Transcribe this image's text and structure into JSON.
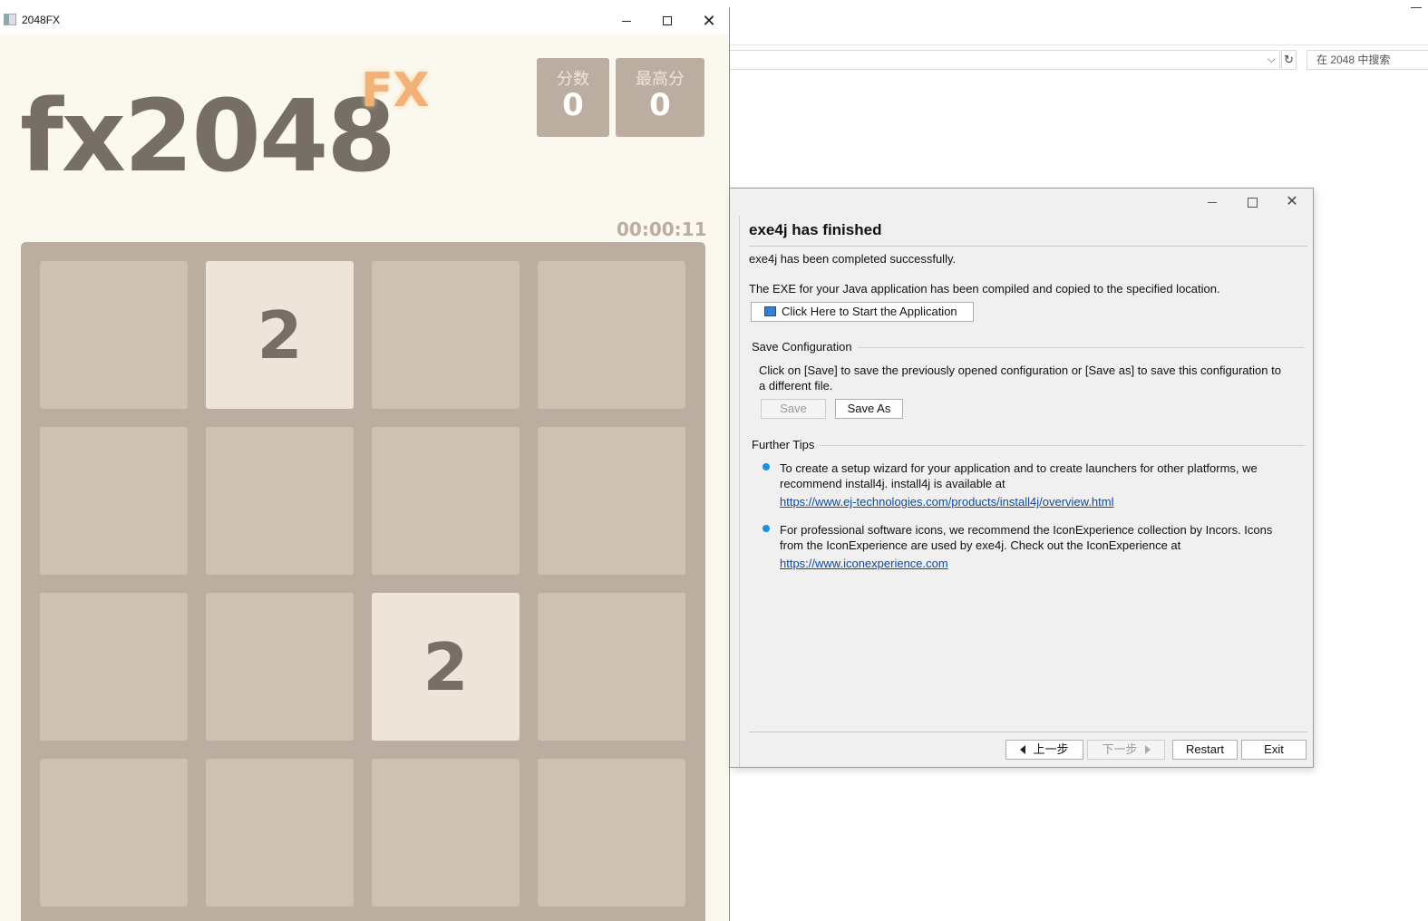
{
  "explorer": {
    "refresh_icon": "↻",
    "search_placeholder": "在 2048 中搜索",
    "chevron_icon": "⌵"
  },
  "game_window": {
    "title": "2048FX",
    "logo": "fx2048",
    "logo_suffix": "FX",
    "score": {
      "label": "分数",
      "value": "0"
    },
    "best": {
      "label": "最高分",
      "value": "0"
    },
    "timer": "00:00:11",
    "board": [
      [
        "",
        "2",
        "",
        ""
      ],
      [
        "",
        "",
        "",
        ""
      ],
      [
        "",
        "",
        "2",
        ""
      ],
      [
        "",
        "",
        "",
        ""
      ]
    ],
    "colors": {
      "background": "#faf8ef",
      "board": "#bbada0",
      "empty_tile": "#cdc1b4",
      "tile_2": "#eee4da",
      "text": "#776e65"
    }
  },
  "dialog": {
    "heading": "exe4j has finished",
    "completed": "exe4j has been completed successfully.",
    "compiled": "The EXE for your Java application has been compiled and copied to the specified location.",
    "start_button": "Click Here to Start the Application",
    "save_section": "Save Configuration",
    "save_desc_1": "Click on [Save] to save the previously opened configuration or [Save as] to save this configuration to",
    "save_desc_2": "a different file.",
    "save_button": "Save",
    "save_as_button": "Save As",
    "tips_section": "Further Tips",
    "tip1_line1": "To create a setup wizard for your application and to create launchers for other platforms, we",
    "tip1_line2": "recommend install4j. install4j is available at",
    "tip1_link": "https://www.ej-technologies.com/products/install4j/overview.html",
    "tip2_line1": "For professional software icons, we recommend the IconExperience collection by Incors. Icons",
    "tip2_line2": "from the IconExperience are used by exe4j. Check out the IconExperience at",
    "tip2_link": "https://www.iconexperience.com",
    "back_button": "上一步",
    "next_button": "下一步",
    "restart_button": "Restart",
    "exit_button": "Exit"
  }
}
